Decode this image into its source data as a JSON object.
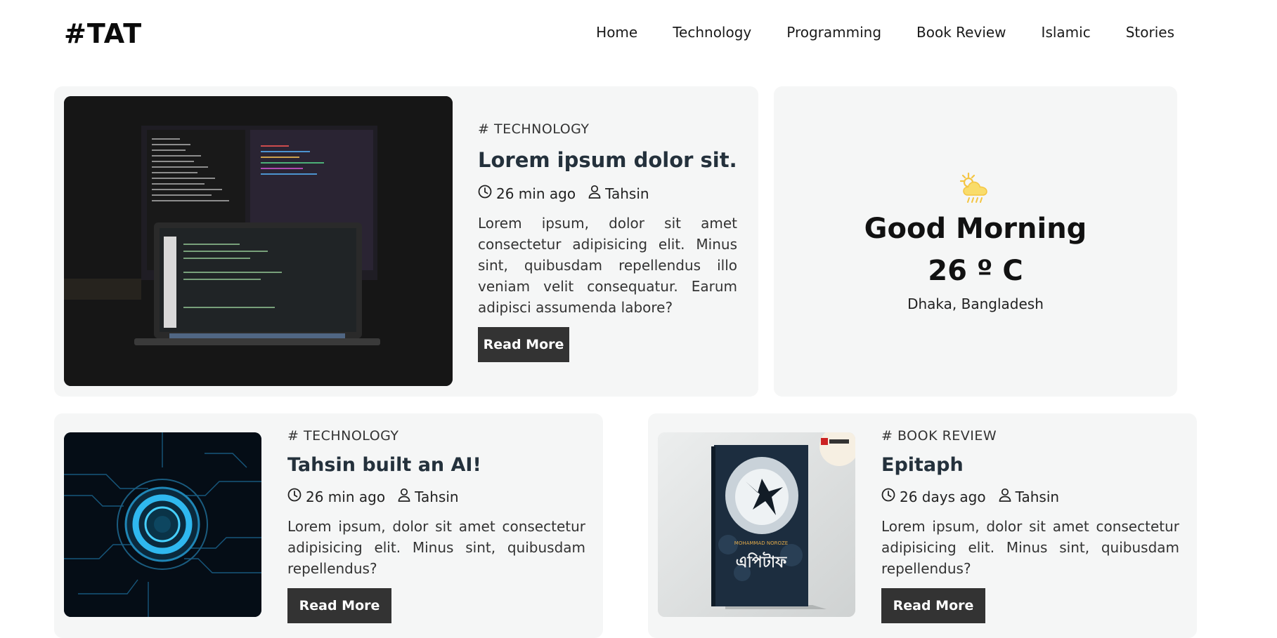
{
  "site": {
    "logo": "#TAT"
  },
  "nav": {
    "items": [
      "Home",
      "Technology",
      "Programming",
      "Book Review",
      "Islamic",
      "Stories"
    ]
  },
  "featured": {
    "tag": "# TECHNOLOGY",
    "title": "Lorem ipsum dolor sit.",
    "time": "26 min ago",
    "author": "Tahsin",
    "desc": "Lorem ipsum, dolor sit amet consectetur adipisicing elit. Minus sint, quibusdam repellendus illo veniam velit consequatur. Earum adipisci assumenda labore?",
    "button": "Read More"
  },
  "weather": {
    "icon": "cloud-sun-rain-icon",
    "greeting": "Good Morning",
    "temperature": "26 º C",
    "location": "Dhaka, Bangladesh"
  },
  "posts": [
    {
      "tag": "# TECHNOLOGY",
      "title": "Tahsin built an AI!",
      "time": "26 min ago",
      "author": "Tahsin",
      "desc": "Lorem ipsum, dolor sit amet consectetur adipisicing elit. Minus sint, quibusdam repellendus?",
      "button": "Read More"
    },
    {
      "tag": "# BOOK REVIEW",
      "title": "Epitaph",
      "time": "26 days ago",
      "author": "Tahsin",
      "desc": "Lorem ipsum, dolor sit amet consectetur adipisicing elit. Minus sint, quibusdam repellendus?",
      "button": "Read More",
      "book": {
        "author_line": "MOHAMMAD NOROZE",
        "title_bn": "এপিটাফ"
      }
    }
  ],
  "colors": {
    "card_bg": "#f5f6f6",
    "button_bg": "#333333",
    "accent_sun": "#f4c542"
  }
}
